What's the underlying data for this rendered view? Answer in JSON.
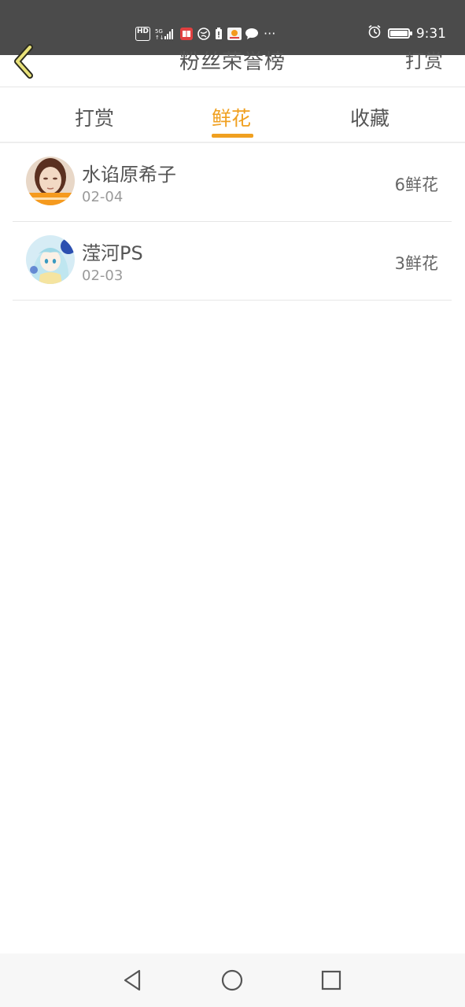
{
  "status_bar": {
    "hd": "HD",
    "more": "···",
    "time": "9:31"
  },
  "header": {
    "title": "粉丝荣誉榜",
    "right_action": "打赏"
  },
  "tabs": [
    {
      "label": "打赏",
      "active": false
    },
    {
      "label": "鲜花",
      "active": true
    },
    {
      "label": "收藏",
      "active": false
    }
  ],
  "colors": {
    "accent": "#f0a020",
    "status_bar_bg": "#4b4b4b",
    "text_primary": "#555555",
    "text_secondary": "#9a9a9a"
  },
  "list": [
    {
      "name": "水谄原希子",
      "date": "02-04",
      "amount": "6鲜花",
      "avatar_icon": "user-avatar-photo"
    },
    {
      "name": "滢河PS",
      "date": "02-03",
      "amount": "3鲜花",
      "avatar_icon": "user-avatar-anime"
    }
  ],
  "nav": {
    "back_icon": "triangle-back-icon",
    "home_icon": "circle-home-icon",
    "recents_icon": "square-recents-icon"
  }
}
